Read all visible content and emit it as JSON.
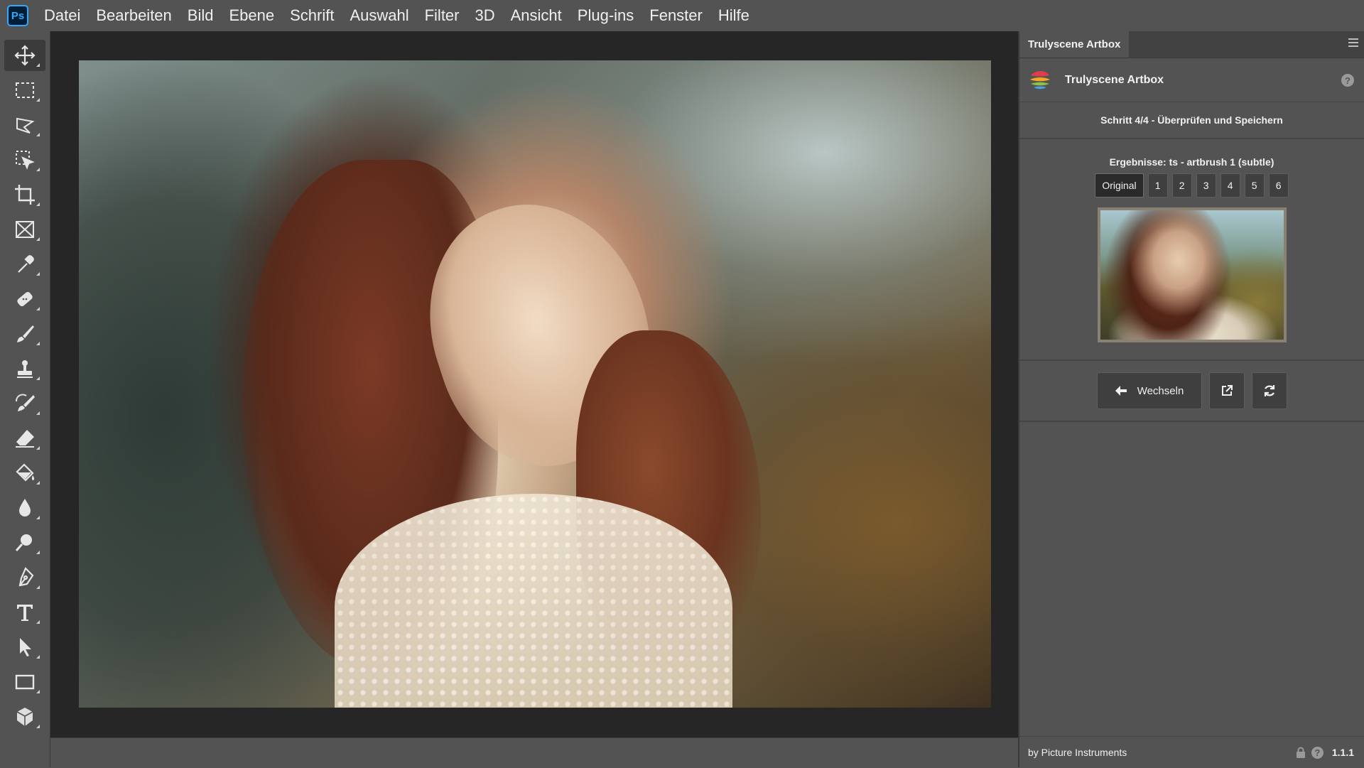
{
  "app": {
    "logo_text": "Ps"
  },
  "menu": [
    "Datei",
    "Bearbeiten",
    "Bild",
    "Ebene",
    "Schrift",
    "Auswahl",
    "Filter",
    "3D",
    "Ansicht",
    "Plug-ins",
    "Fenster",
    "Hilfe"
  ],
  "tools": [
    {
      "name": "move-tool-icon",
      "active": true
    },
    {
      "name": "rectangular-marquee-tool-icon"
    },
    {
      "name": "lasso-tool-icon"
    },
    {
      "name": "object-selection-tool-icon"
    },
    {
      "name": "crop-tool-icon"
    },
    {
      "name": "frame-tool-icon"
    },
    {
      "name": "eyedropper-tool-icon"
    },
    {
      "name": "healing-brush-tool-icon"
    },
    {
      "name": "brush-tool-icon"
    },
    {
      "name": "clone-stamp-tool-icon"
    },
    {
      "name": "history-brush-tool-icon"
    },
    {
      "name": "eraser-tool-icon"
    },
    {
      "name": "paint-bucket-tool-icon"
    },
    {
      "name": "blur-tool-icon"
    },
    {
      "name": "dodge-tool-icon"
    },
    {
      "name": "pen-tool-icon"
    },
    {
      "name": "type-tool-icon"
    },
    {
      "name": "path-selection-tool-icon"
    },
    {
      "name": "rectangle-tool-icon"
    },
    {
      "name": "3d-object-tool-icon"
    }
  ],
  "panel": {
    "tab_label": "Trulyscene Artbox",
    "plugin_title": "Trulyscene Artbox",
    "help_glyph": "?",
    "step": "Schritt 4/4 - Überprüfen und Speichern",
    "results_label": "Ergebnisse: ts - artbrush 1 (subtle)",
    "result_tabs": [
      "Original",
      "1",
      "2",
      "3",
      "4",
      "5",
      "6"
    ],
    "selected_tab": "Original",
    "switch_label": "Wechseln",
    "footer_text": "by Picture Instruments",
    "version": "1.1.1"
  }
}
